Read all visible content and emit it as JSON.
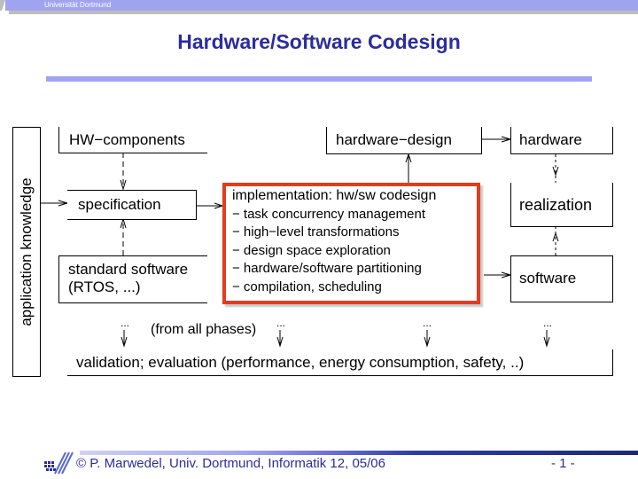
{
  "header": {
    "institution": "Universität Dortmund",
    "title": "Hardware/Software Codesign"
  },
  "diagram": {
    "side_label": "application knowledge",
    "hw_components": "HW−components",
    "specification": "specification",
    "standard_software_line1": "standard software",
    "standard_software_line2": "(RTOS, ...)",
    "hardware_design": "hardware−design",
    "hardware": "hardware",
    "realization": "realization",
    "software": "software",
    "implementation": {
      "heading": "implementation: hw/sw codesign",
      "items": [
        "− task concurrency management",
        "− high−level transformations",
        "− design space exploration",
        "− hardware/software partitioning",
        "− compilation, scheduling"
      ],
      "highlight_color": "#e23c1e"
    },
    "from_all_phases": "(from all phases)",
    "ellipsis": "...",
    "validation": "validation; evaluation (performance, energy consumption, safety, ..)"
  },
  "footer": {
    "credit": "© P. Marwedel, Univ. Dortmund, Informatik 12, 05/06",
    "page": "- 1 -"
  },
  "colors": {
    "title": "#2c2c9e",
    "accent_bar": "#a0a4f0"
  }
}
